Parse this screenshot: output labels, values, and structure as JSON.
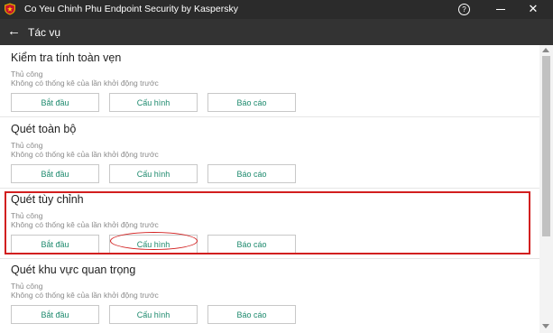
{
  "window": {
    "title": "Co Yeu Chinh Phu Endpoint Security by Kaspersky",
    "help_symbol": "?",
    "close_symbol": "✕"
  },
  "nav": {
    "back_symbol": "←",
    "title": "Tác vụ"
  },
  "tasks": [
    {
      "title": "Kiểm tra tính toàn vẹn",
      "mode": "Thủ công",
      "status": "Không có thống kê của lần khởi động trước",
      "start": "Bắt đầu",
      "configure": "Cấu hình",
      "report": "Báo cáo"
    },
    {
      "title": "Quét toàn bộ",
      "mode": "Thủ công",
      "status": "Không có thống kê của lần khởi động trước",
      "start": "Bắt đầu",
      "configure": "Cấu hình",
      "report": "Báo cáo"
    },
    {
      "title": "Quét tùy chỉnh",
      "mode": "Thủ công",
      "status": "Không có thống kê của lần khởi động trước",
      "start": "Bắt đầu",
      "configure": "Cấu hình",
      "report": "Báo cáo"
    },
    {
      "title": "Quét khu vực quan trọng",
      "mode": "Thủ công",
      "status": "Không có thống kê của lần khởi động trước",
      "start": "Bắt đầu",
      "configure": "Cấu hình",
      "report": "Báo cáo"
    }
  ],
  "colors": {
    "titlebar": "#2b2b2b",
    "navbar": "#333333",
    "button_text": "#1e8a6e",
    "annotation": "#d21f1f"
  },
  "icons": [
    "app-logo-icon",
    "help-icon",
    "minimize-icon",
    "close-icon",
    "back-arrow-icon"
  ]
}
